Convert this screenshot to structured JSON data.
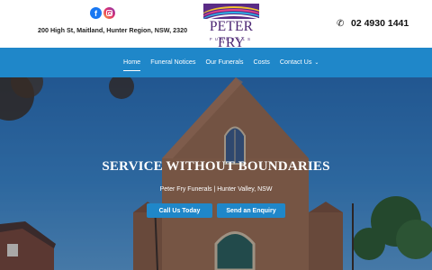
{
  "header": {
    "social": [
      {
        "icon": "facebook-icon",
        "glyph": "f"
      },
      {
        "icon": "instagram-icon"
      }
    ],
    "address": "200 High St, Maitland, Hunter Region, NSW, 2320",
    "logo": {
      "name": "PETER FRY",
      "tagline": "FUNERALS"
    },
    "phone": {
      "icon": "phone-icon",
      "number": "02 4930 1441"
    }
  },
  "nav": {
    "items": [
      {
        "label": "Home",
        "active": true
      },
      {
        "label": "Funeral Notices"
      },
      {
        "label": "Our Funerals"
      },
      {
        "label": "Costs"
      },
      {
        "label": "Contact Us"
      }
    ],
    "dropdown_glyph": "⌄"
  },
  "hero": {
    "title": "SERVICE WITHOUT BOUNDARIES",
    "subtitle": "Peter Fry Funerals | Hunter Valley, NSW",
    "buttons": {
      "call": "Call Us Today",
      "enquiry": "Send an Enquiry"
    }
  },
  "colors": {
    "accent": "#1f87c9",
    "brand": "#4a2472"
  }
}
